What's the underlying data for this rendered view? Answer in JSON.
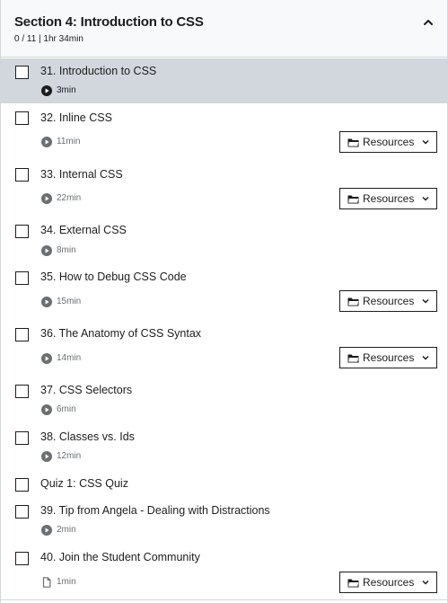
{
  "section": {
    "title": "Section 4: Introduction to CSS",
    "meta": "0 / 11 | 1hr 34min"
  },
  "resources_label": "Resources",
  "lectures": [
    {
      "title": "31. Introduction to CSS",
      "duration": "3min",
      "icon": "play-icon",
      "active": true,
      "resources": false
    },
    {
      "title": "32. Inline CSS",
      "duration": "11min",
      "icon": "play-icon",
      "resources": true
    },
    {
      "title": "33. Internal CSS",
      "duration": "22min",
      "icon": "play-icon",
      "resources": true
    },
    {
      "title": "34. External CSS",
      "duration": "8min",
      "icon": "play-icon",
      "resources": false
    },
    {
      "title": "35. How to Debug CSS Code",
      "duration": "15min",
      "icon": "play-icon",
      "resources": true
    },
    {
      "title": "36. The Anatomy of CSS Syntax",
      "duration": "14min",
      "icon": "play-icon",
      "resources": true
    },
    {
      "title": "37. CSS Selectors",
      "duration": "6min",
      "icon": "play-icon",
      "resources": false
    },
    {
      "title": "38. Classes vs. Ids",
      "duration": "12min",
      "icon": "play-icon",
      "resources": false
    },
    {
      "title": "Quiz 1: CSS Quiz",
      "duration": "",
      "icon": "",
      "resources": false
    },
    {
      "title": "39. Tip from Angela - Dealing with Distractions",
      "duration": "2min",
      "icon": "play-icon",
      "resources": false
    },
    {
      "title": "40. Join the Student Community",
      "duration": "1min",
      "icon": "file-icon",
      "resources": true
    }
  ],
  "colors": {
    "text": "#1c1d1f",
    "muted": "#6a6f73",
    "active_row": "#d1d7dc",
    "header_bg": "#f7f9fa"
  }
}
